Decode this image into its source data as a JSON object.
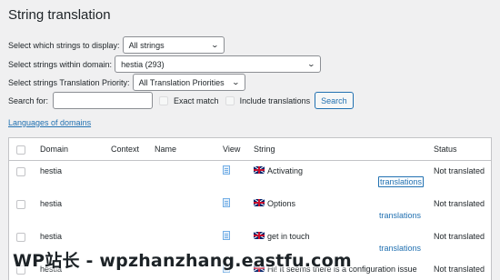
{
  "page": {
    "title": "String translation"
  },
  "filters": {
    "display_label": "Select which strings to display:",
    "display_value": "All strings",
    "domain_label": "Select strings within domain:",
    "domain_value": "hestia (293)",
    "priority_label": "Select strings Translation Priority:",
    "priority_value": "All Translation Priorities",
    "search_label": "Search for:",
    "search_value": "",
    "exact_match_label": "Exact match",
    "include_translations_label": "Include translations",
    "search_button": "Search"
  },
  "languages_link": "Languages of domains",
  "table": {
    "headers": {
      "domain": "Domain",
      "context": "Context",
      "name": "Name",
      "view": "View",
      "string": "String",
      "status": "Status"
    },
    "rows": [
      {
        "domain": "hestia",
        "string": "Activating",
        "translations": "translations",
        "status": "Not translated"
      },
      {
        "domain": "hestia",
        "string": "Options",
        "translations": "translations",
        "status": "Not translated"
      },
      {
        "domain": "hestia",
        "string": "get in touch",
        "translations": "translations",
        "status": "Not translated"
      },
      {
        "domain": "hestia",
        "string": "Hi! It seems there is a configuration issue",
        "translations": "",
        "status": "Not translated"
      }
    ]
  },
  "watermark": "WP站长 - wpzhanzhang.eastfu.com",
  "colors": {
    "link": "#2271b1",
    "background": "#f0f0f1",
    "border": "#c3c4c7"
  },
  "icons": {
    "view": "document-icon",
    "flag": "uk-flag-icon",
    "dropdown": "chevron-down-icon"
  }
}
